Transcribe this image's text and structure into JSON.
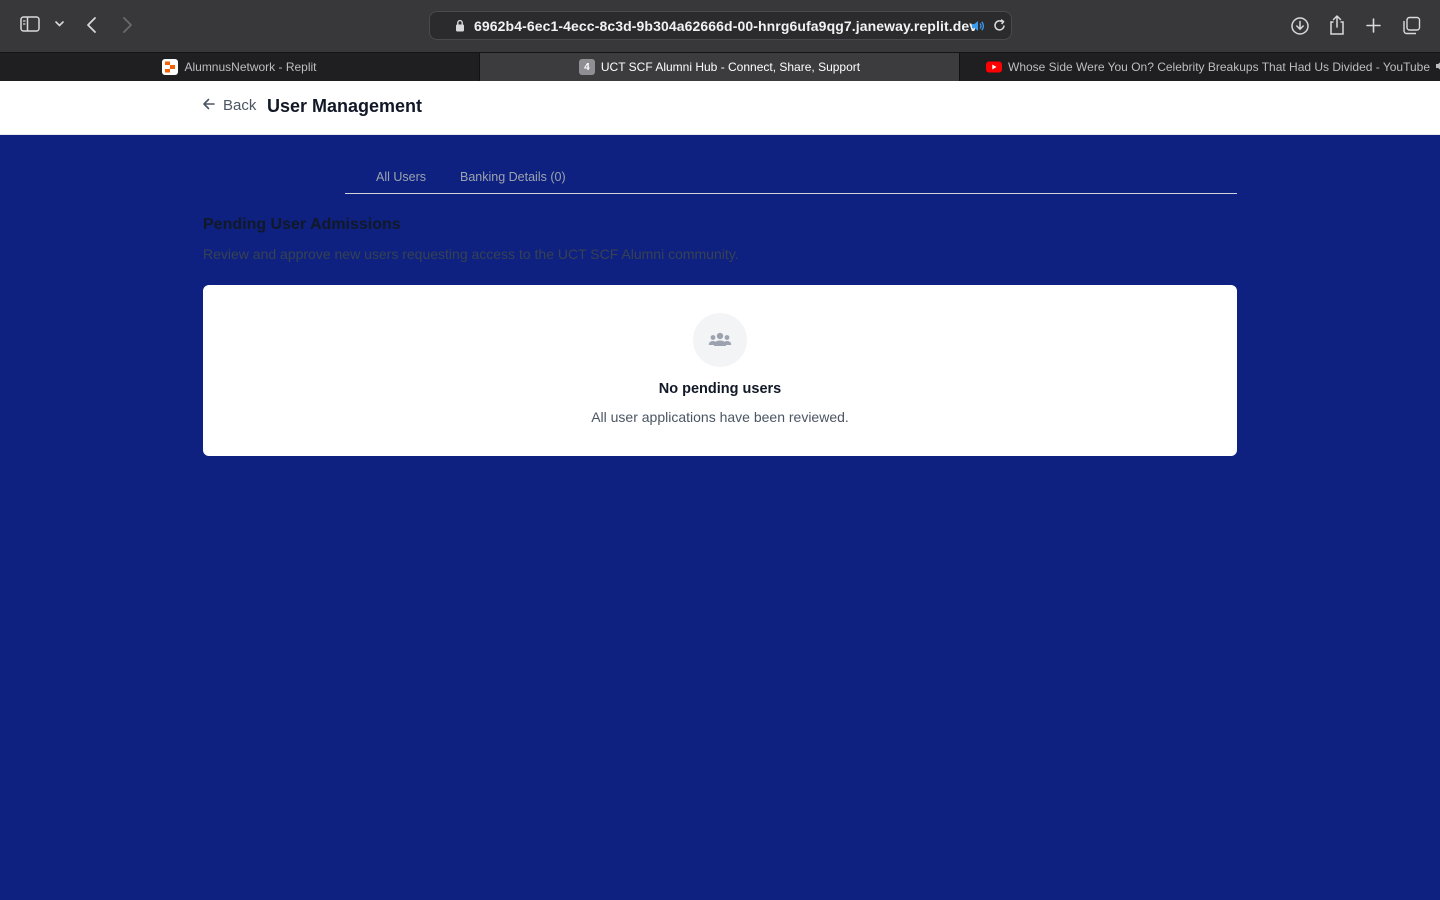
{
  "browser": {
    "url": "6962b4-6ec1-4ecc-8c3d-9b304a62666d-00-hnrg6ufa9qg7.janeway.replit.dev",
    "tabs": [
      {
        "title": "AlumnusNetwork - Replit",
        "favicon": "replit-logo",
        "active": false
      },
      {
        "title": "UCT SCF Alumni Hub - Connect, Share, Support",
        "favicon": "4",
        "active": true
      },
      {
        "title": "Whose Side Were You On? Celebrity Breakups That Had Us Divided - YouTube",
        "favicon": "youtube-logo",
        "active": false
      }
    ]
  },
  "header": {
    "back_label": "Back",
    "title": "User Management"
  },
  "tabs": [
    {
      "label": "All Users"
    },
    {
      "label": "Banking Details (0)"
    }
  ],
  "section": {
    "title": "Pending User Admissions",
    "description": "Review and approve new users requesting access to the UCT SCF Alumni community."
  },
  "empty_state": {
    "icon": "users-icon",
    "title": "No pending users",
    "description": "All user applications have been reviewed."
  },
  "colors": {
    "page_background": "#0e2180",
    "card_background": "#ffffff",
    "browser_chrome": "#38383b"
  }
}
